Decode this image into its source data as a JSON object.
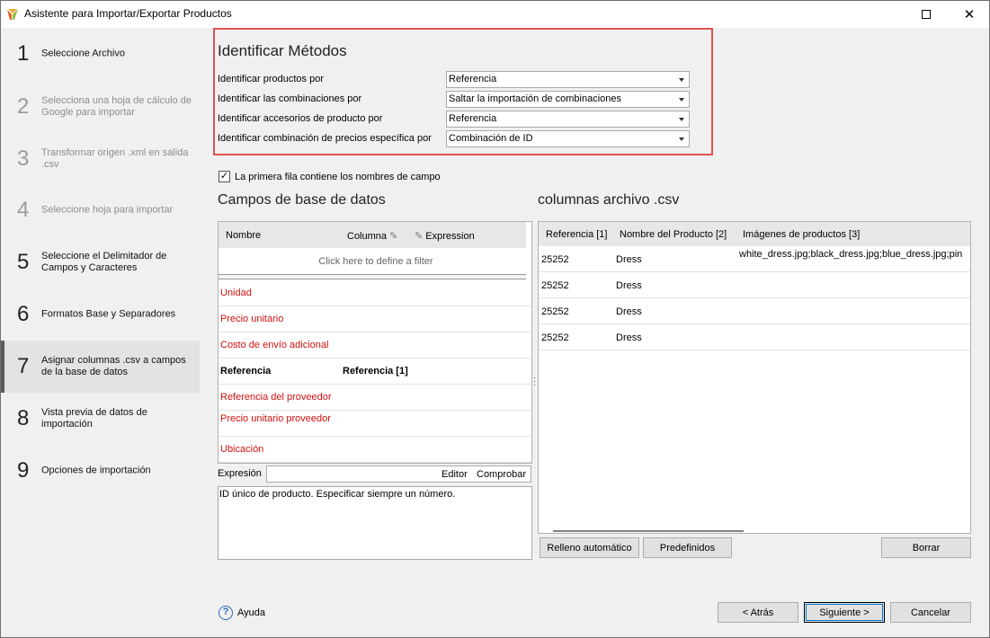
{
  "window": {
    "title": "Asistente para Importar/Exportar Productos",
    "maximize_glyph": "□",
    "close_glyph": "✕"
  },
  "sidebar": {
    "steps": [
      {
        "num": "1",
        "label": "Seleccione Archivo",
        "state": "normal"
      },
      {
        "num": "2",
        "label": "Selecciona una hoja de cálculo de Google para importar",
        "state": "disabled"
      },
      {
        "num": "3",
        "label": "Transformar origen .xml en salida .csv",
        "state": "disabled"
      },
      {
        "num": "4",
        "label": "Seleccione hoja para importar",
        "state": "disabled"
      },
      {
        "num": "5",
        "label": "Seleccione el Delimitador de Campos y Caracteres",
        "state": "normal"
      },
      {
        "num": "6",
        "label": "Formatos Base y Separadores",
        "state": "normal"
      },
      {
        "num": "7",
        "label": "Asignar columnas .csv a campos de la base de datos",
        "state": "active"
      },
      {
        "num": "8",
        "label": "Vista previa de datos de importación",
        "state": "normal"
      },
      {
        "num": "9",
        "label": "Opciones de importación",
        "state": "normal"
      }
    ]
  },
  "identify": {
    "title": "Identificar Métodos",
    "rows": [
      {
        "label": "Identificar productos por",
        "value": "Referencia"
      },
      {
        "label": "Identificar las combinaciones por",
        "value": "Saltar la importación de combinaciones"
      },
      {
        "label": "Identificar accesorios de producto por",
        "value": "Referencia"
      },
      {
        "label": "Identificar combinación de precios específica por",
        "value": "Combinación de ID"
      }
    ]
  },
  "first_row_checkbox": {
    "label": "La primera fila contiene los nombres de campo",
    "checked": true,
    "mark": "✓"
  },
  "db_fields": {
    "title": "Campos de base de datos",
    "header_nombre": "Nombre",
    "header_columna": "Columna",
    "header_expression": "Expression",
    "filter_text": "Click here to define a filter",
    "rows": [
      {
        "name": "Unidad",
        "column": ""
      },
      {
        "name": "Precio unitario",
        "column": ""
      },
      {
        "name": "Costo de envío adicional",
        "column": ""
      },
      {
        "name": "Referencia",
        "column": "Referencia [1]"
      },
      {
        "name": "Referencia del proveedor",
        "column": ""
      },
      {
        "name": "Precio unitario proveedor",
        "column": ""
      },
      {
        "name": "Ubicación",
        "column": ""
      }
    ],
    "expression_label": "Expresión",
    "editor_link": "Editor",
    "check_link": "Comprobar",
    "description": "ID único de producto. Especificar siempre un número."
  },
  "csv_columns": {
    "title": "columnas archivo .csv",
    "headers": [
      "Referencia [1]",
      "Nombre del Producto [2]",
      "Imágenes de productos [3]"
    ],
    "rows": [
      [
        "25252",
        "Dress",
        "white_dress.jpg;black_dress.jpg;blue_dress.jpg;pin"
      ],
      [
        "25252",
        "Dress",
        ""
      ],
      [
        "25252",
        "Dress",
        ""
      ],
      [
        "25252",
        "Dress",
        ""
      ]
    ],
    "autofill_button": "Relleno automático",
    "predefined_button": "Predefinidos",
    "delete_button": "Borrar"
  },
  "footer": {
    "help": "Ayuda",
    "help_glyph": "?",
    "back": "< Atrás",
    "next": "Siguiente >",
    "cancel": "Cancelar"
  }
}
